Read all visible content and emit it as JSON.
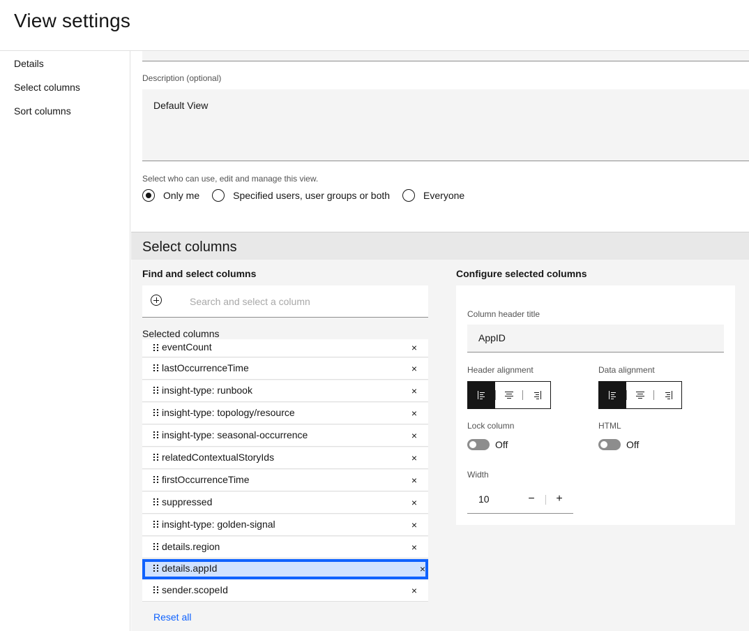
{
  "header": {
    "title": "View settings"
  },
  "sidebar": {
    "items": [
      {
        "label": "Details"
      },
      {
        "label": "Select columns"
      },
      {
        "label": "Sort columns"
      }
    ]
  },
  "details": {
    "description_label": "Description (optional)",
    "description_value": "Default View",
    "permission_label": "Select who can use, edit and manage this view.",
    "permission_options": [
      {
        "label": "Only me",
        "checked": true
      },
      {
        "label": "Specified users, user groups or both",
        "checked": false
      },
      {
        "label": "Everyone",
        "checked": false
      }
    ]
  },
  "select_columns": {
    "section_title": "Select columns",
    "find_title": "Find and select columns",
    "search_placeholder": "Search and select a column",
    "selected_label": "Selected columns",
    "columns": [
      "eventCount",
      "lastOccurrenceTime",
      "insight-type: runbook",
      "insight-type: topology/resource",
      "insight-type: seasonal-occurrence",
      "relatedContextualStoryIds",
      "firstOccurrenceTime",
      "suppressed",
      "insight-type: golden-signal",
      "details.region",
      "details.appId",
      "sender.scopeId"
    ],
    "active_column": "details.appId",
    "remove_glyph": "×",
    "reset_label": "Reset all"
  },
  "configure": {
    "title": "Configure selected columns",
    "header_title_label": "Column header title",
    "header_title_value": "AppID",
    "header_alignment_label": "Header alignment",
    "data_alignment_label": "Data alignment",
    "header_alignment_selected": "left",
    "data_alignment_selected": "left",
    "lock_label": "Lock column",
    "lock_state": "Off",
    "html_label": "HTML",
    "html_state": "Off",
    "width_label": "Width",
    "width_value": "10",
    "minus_glyph": "−",
    "plus_glyph": "+"
  },
  "colors": {
    "accent": "#0f62fe",
    "active_row_bg": "#d0e2ff",
    "section_bg": "#f4f4f4",
    "text": "#161616"
  }
}
